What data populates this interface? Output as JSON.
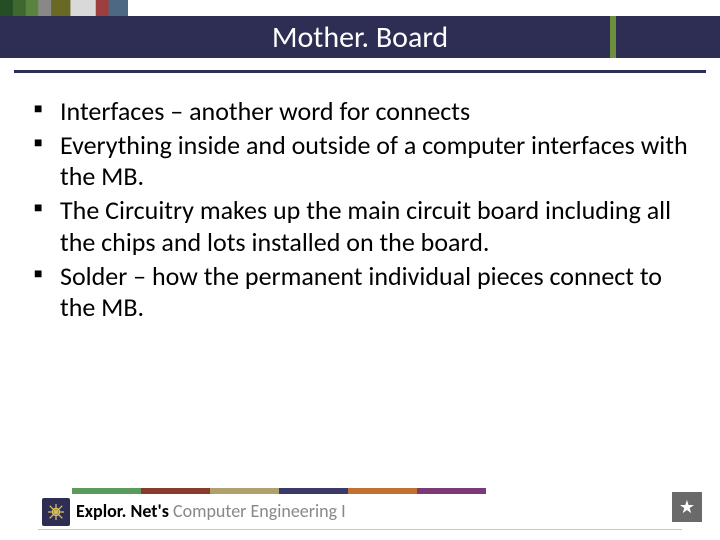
{
  "slide": {
    "title": "Mother. Board"
  },
  "bullets": [
    "Interfaces – another word for connects",
    "Everything inside and outside of a computer interfaces with the MB.",
    "The Circuitry makes up the main circuit board including all the chips and lots installed on the board.",
    "Solder – how the permanent individual pieces connect to the MB."
  ],
  "footer": {
    "brand_bold": "Explor. Net's ",
    "brand_grey": "Computer Engineering I"
  },
  "colors": {
    "titlebar": "#2e2e54",
    "accent": "#6f8f3f"
  }
}
